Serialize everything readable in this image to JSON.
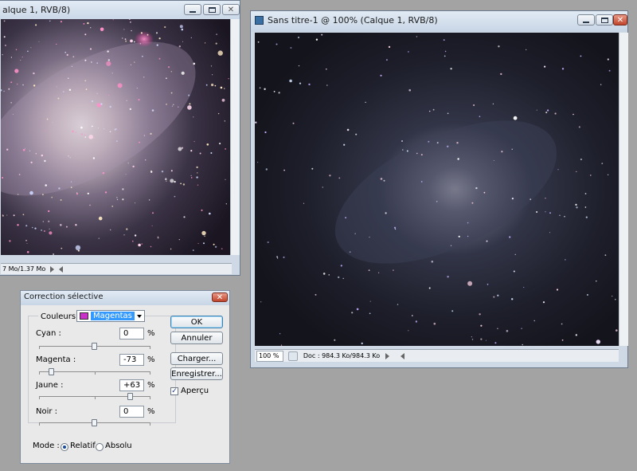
{
  "window_left": {
    "title": "alque 1, RVB/8)",
    "status_doc": "7 Mo/1.37 Mo"
  },
  "window_right": {
    "title": "Sans titre-1 @ 100% (Calque 1, RVB/8)",
    "zoom": "100 %",
    "status_doc": "Doc : 984.3 Ko/984.3 Ko"
  },
  "dialog": {
    "title": "Correction sélective",
    "close_glyph": "✕",
    "couleurs_label": "Couleurs :",
    "couleurs_value": "Magentas",
    "couleurs_swatch": "#c832c8",
    "rows": [
      {
        "label": "Cyan :",
        "value": "0",
        "unit": "%"
      },
      {
        "label": "Magenta :",
        "value": "-73",
        "unit": "%"
      },
      {
        "label": "Jaune :",
        "value": "+63",
        "unit": "%"
      },
      {
        "label": "Noir :",
        "value": "0",
        "unit": "%"
      }
    ],
    "buttons": {
      "ok": "OK",
      "annuler": "Annuler",
      "charger": "Charger...",
      "enregistrer": "Enregistrer..."
    },
    "apercu_label": "Aperçu",
    "apercu_checked": true,
    "apercu_check_glyph": "✓",
    "mode_label": "Mode :",
    "mode_relatif": "Relatif",
    "mode_absolu": "Absolu",
    "mode_selected": "Relatif"
  }
}
